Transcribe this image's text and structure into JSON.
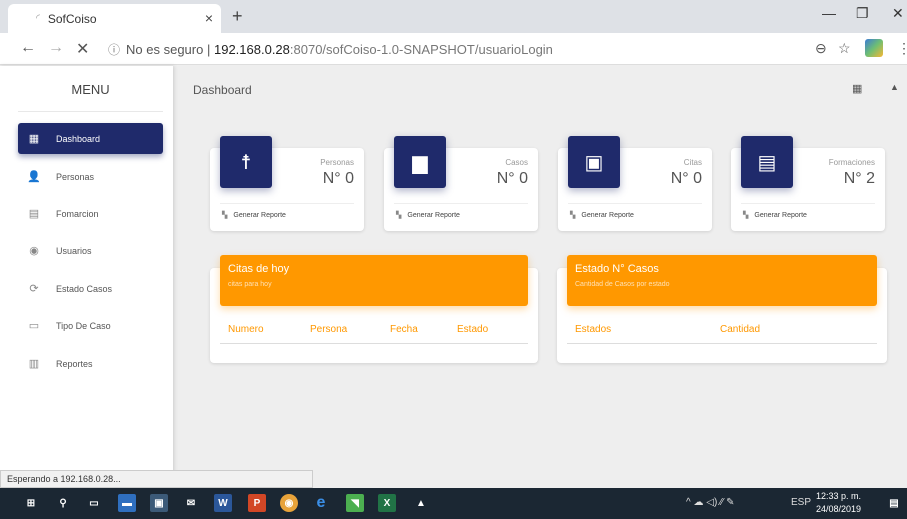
{
  "browser": {
    "tab_title": "SofCoiso",
    "tab_close": "×",
    "new_tab": "+",
    "controls": {
      "minimize": "—",
      "maximize": "❐",
      "close": "✕"
    },
    "nav": {
      "back": "←",
      "forward": "→",
      "stop": "✕"
    },
    "url": {
      "info": "ⓘ",
      "security": "No es seguro",
      "separator": "|",
      "host": "192.168.0.28",
      "path": ":8070/sofCoiso-1.0-SNAPSHOT/usuarioLogin"
    },
    "zoom_icon": "⊖",
    "star_icon": "☆",
    "menu_icon": "⋮"
  },
  "sidebar": {
    "title": "MENU",
    "items": [
      {
        "label": "Dashboard",
        "icon": "dashboard-icon",
        "glyph": "▦",
        "active": true
      },
      {
        "label": "Personas",
        "icon": "person-icon",
        "glyph": "👤",
        "active": false
      },
      {
        "label": "Fomarcion",
        "icon": "content-paste-icon",
        "glyph": "▤",
        "active": false
      },
      {
        "label": "Usuarios",
        "icon": "account-circle-icon",
        "glyph": "◉",
        "active": false
      },
      {
        "label": "Estado Casos",
        "icon": "sync-icon",
        "glyph": "⟳",
        "active": false
      },
      {
        "label": "Tipo De Caso",
        "icon": "folder-icon",
        "glyph": "▭",
        "active": false
      },
      {
        "label": "Reportes",
        "icon": "chart-icon",
        "glyph": "▥",
        "active": false
      }
    ]
  },
  "topbar": {
    "title": "Dashboard",
    "dashboard_icon": "▦",
    "person_icon": "▲"
  },
  "cards": [
    {
      "category": "Personas",
      "value": "N° 0",
      "icon": "accessibility-icon",
      "glyph": "☨",
      "footer": "Generar Reporte"
    },
    {
      "category": "Casos",
      "value": "N° 0",
      "icon": "store-icon",
      "glyph": "▆",
      "footer": "Generar Reporte"
    },
    {
      "category": "Citas",
      "value": "N° 0",
      "icon": "calendar-icon",
      "glyph": "▣",
      "footer": "Generar Reporte"
    },
    {
      "category": "Formaciones",
      "value": "N° 2",
      "icon": "event-note-icon",
      "glyph": "▤",
      "footer": "Generar Reporte"
    }
  ],
  "citas": {
    "title": "Citas de hoy",
    "subtitle": "citas para hoy",
    "columns": [
      "Numero",
      "Persona",
      "Fecha",
      "Estado"
    ]
  },
  "estado": {
    "title": "Estado N° Casos",
    "subtitle": "Cantidad de Casos por estado",
    "columns": [
      "Estados",
      "Cantidad"
    ]
  },
  "status_text": "Esperando a 192.168.0.28...",
  "taskbar": {
    "tray_lang": "ESP",
    "time": "12:33 p. m.",
    "date": "24/08/2019",
    "tray_icons": "^ ☁ ◁) ⁄⁄ ✎"
  },
  "colors": {
    "primary": "#1f2a6b",
    "accent": "#ff9800"
  }
}
